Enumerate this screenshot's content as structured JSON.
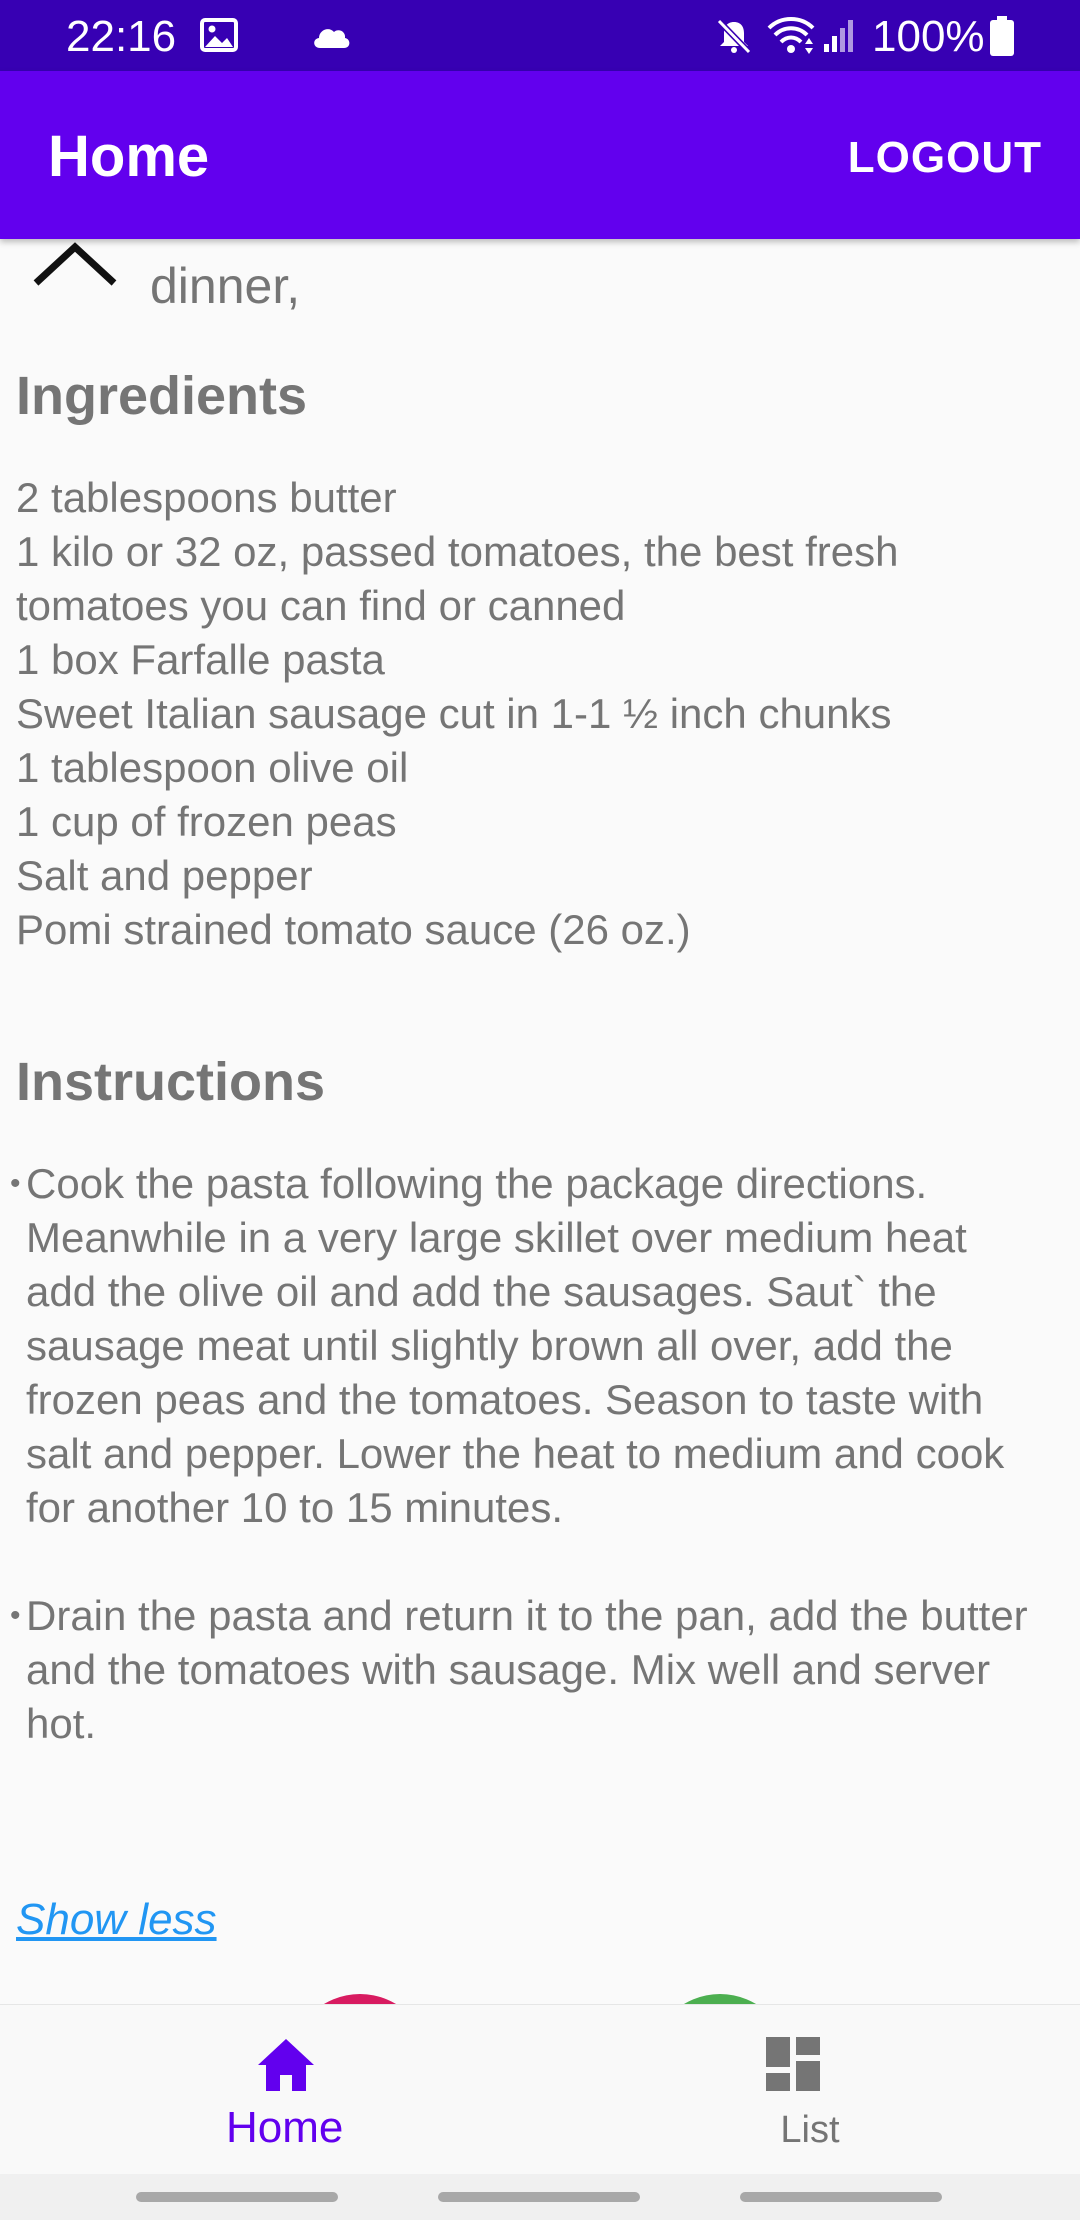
{
  "status_bar": {
    "time": "22:16",
    "battery": "100%",
    "icons": [
      "gallery-icon",
      "cloud-icon",
      "mute-icon",
      "wifi-icon",
      "signal-icon",
      "battery-icon"
    ]
  },
  "app_bar": {
    "title": "Home",
    "logout_label": "LOGOUT",
    "color": "#6200ee"
  },
  "recipe": {
    "meta_line": "dinner,",
    "ingredients_heading": "Ingredients",
    "ingredients": [
      "2 tablespoons butter",
      "1 kilo or 32 oz, passed tomatoes, the best fresh tomatoes you can find or canned",
      "1 box Farfalle pasta",
      "Sweet Italian sausage cut in 1-1 ½ inch chunks",
      "1 tablespoon olive oil",
      "1 cup of frozen peas",
      "Salt and pepper",
      "Pomi strained tomato sauce (26 oz.)"
    ],
    "instructions_heading": "Instructions",
    "instructions": [
      "Cook the pasta following the package directions. Meanwhile in a very large skillet over medium heat add the olive oil and add the sausages. Saut` the sausage meat until slightly brown all over, add the frozen peas and the tomatoes. Season to taste with salt and pepper. Lower the heat to medium and cook for another 10 to 15 minutes.",
      "Drain the pasta and return it to the pan, add the butter and the tomatoes with sausage. Mix well and server hot."
    ],
    "bullet": "•",
    "show_less_label": "Show less"
  },
  "bottom_nav": {
    "home_label": "Home",
    "list_label": "List",
    "active": "Home",
    "active_color": "#6200ee"
  }
}
